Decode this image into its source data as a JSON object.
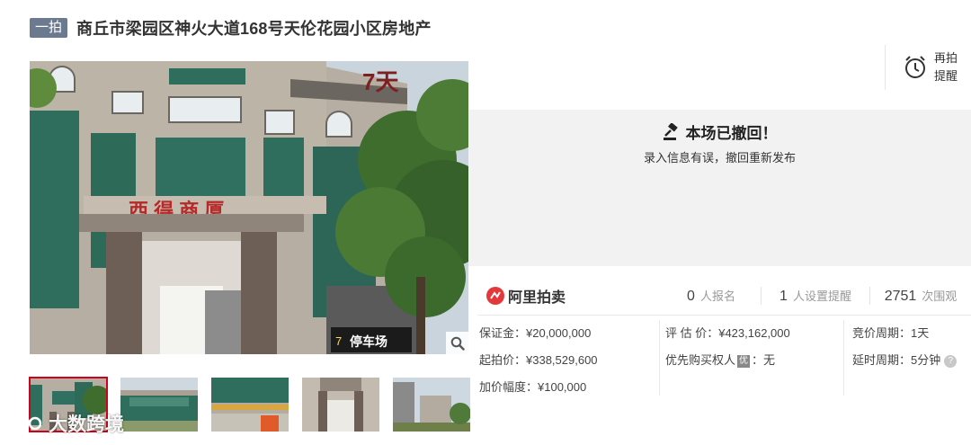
{
  "header": {
    "badge": "一拍",
    "title": "商丘市梁园区神火大道168号天伦花园小区房地产"
  },
  "remind": {
    "icon": "alarm-clock-icon",
    "line1": "再拍",
    "line2": "提醒"
  },
  "status": {
    "icon": "auction-hammer-icon",
    "title": "本场已撤回！",
    "subtitle": "录入信息有误，撤回重新发布"
  },
  "brand": {
    "name": "阿里拍卖",
    "color": "#e5383b"
  },
  "stats": [
    {
      "num": "0",
      "label": "人报名"
    },
    {
      "num": "1",
      "label": "人设置提醒"
    },
    {
      "num": "2751",
      "label": "次围观"
    }
  ],
  "info": {
    "deposit": "保证金：¥20,000,000",
    "start_price": "起拍价：¥338,529,600",
    "increment": "加价幅度：¥100,000",
    "appraisal": "评 估 价：¥423,162,000",
    "priority_label": "优先购买权人",
    "priority_tag": "优",
    "priority_value": "：无",
    "bid_cycle": "竞价周期：1天",
    "delay_cycle": "延时周期：5分钟",
    "help_icon": "?"
  },
  "photo_sign": "停车场",
  "watermark": "大数跨境",
  "zoom_icon": "magnifier-icon"
}
